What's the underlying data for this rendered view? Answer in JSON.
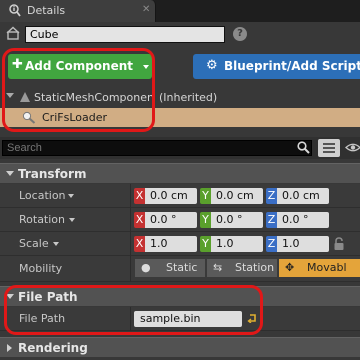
{
  "tab": {
    "title": "Details",
    "icon": "magnifier-info-icon",
    "close_icon": "close-icon"
  },
  "header": {
    "actor_name": "Cube",
    "help_icon": "?",
    "add_component_label": "Add Component",
    "blueprint_label": "Blueprint/Add Script"
  },
  "components": {
    "parent_label": "StaticMeshComponent",
    "parent_suffix": "(Inherited)",
    "child_label": "CriFsLoader"
  },
  "search": {
    "placeholder": "Search"
  },
  "sections": {
    "transform": {
      "title": "Transform",
      "location_label": "Location",
      "rotation_label": "Rotation",
      "scale_label": "Scale",
      "mobility_label": "Mobility",
      "location": {
        "x": "0.0 cm",
        "y": "0.0 cm",
        "z": "0.0 cm"
      },
      "rotation": {
        "x": "0.0 °",
        "y": "0.0 °",
        "z": "0.0 °"
      },
      "scale": {
        "x": "1.0",
        "y": "1.0",
        "z": "1.0"
      },
      "axis_labels": {
        "x": "X",
        "y": "Y",
        "z": "Z"
      },
      "mobility_options": [
        "Static",
        "Station",
        "Movabl"
      ],
      "mobility_selected": "Movabl"
    },
    "file_path": {
      "title": "File Path",
      "label": "File Path",
      "value": "sample.bin"
    },
    "rendering": {
      "title": "Rendering"
    }
  },
  "colors": {
    "add_button": "#41a63f",
    "blueprint_button": "#2c6fb8",
    "selected_component": "#d1ad84",
    "mobility_active": "#e4a43a",
    "annotation": "#e01818",
    "axis_x": "#c43131",
    "axis_y": "#5aa02c",
    "axis_z": "#3a6ec5"
  }
}
